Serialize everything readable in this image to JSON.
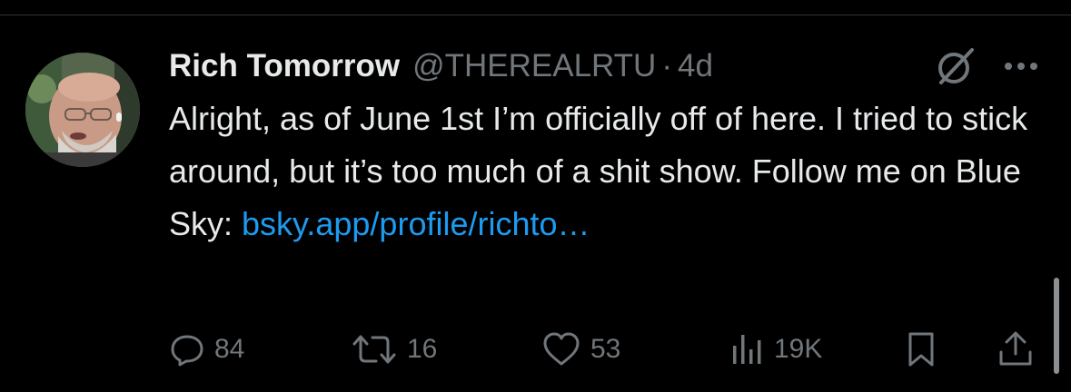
{
  "tweet": {
    "author": {
      "display_name": "Rich Tomorrow",
      "handle": "@THEREALRTU",
      "separator": "·",
      "timestamp": "4d"
    },
    "text_prefix": "Alright, as of June 1st I’m officially off of here. I tried to stick around, but it’s too much of a shit show. Follow me on Blue Sky: ",
    "link_text": "bsky.app/profile/richto…",
    "header_icons": [
      "grok-icon",
      "more-icon"
    ],
    "actions": {
      "reply": {
        "icon": "reply-icon",
        "count": "84"
      },
      "retweet": {
        "icon": "retweet-icon",
        "count": "16"
      },
      "like": {
        "icon": "heart-icon",
        "count": "53"
      },
      "views": {
        "icon": "analytics-icon",
        "count": "19K"
      },
      "bookmark": {
        "icon": "bookmark-icon"
      },
      "share": {
        "icon": "share-icon"
      }
    }
  },
  "colors": {
    "background": "#000000",
    "text_primary": "#e7e9ea",
    "text_secondary": "#71767b",
    "link": "#1d9bf0"
  }
}
